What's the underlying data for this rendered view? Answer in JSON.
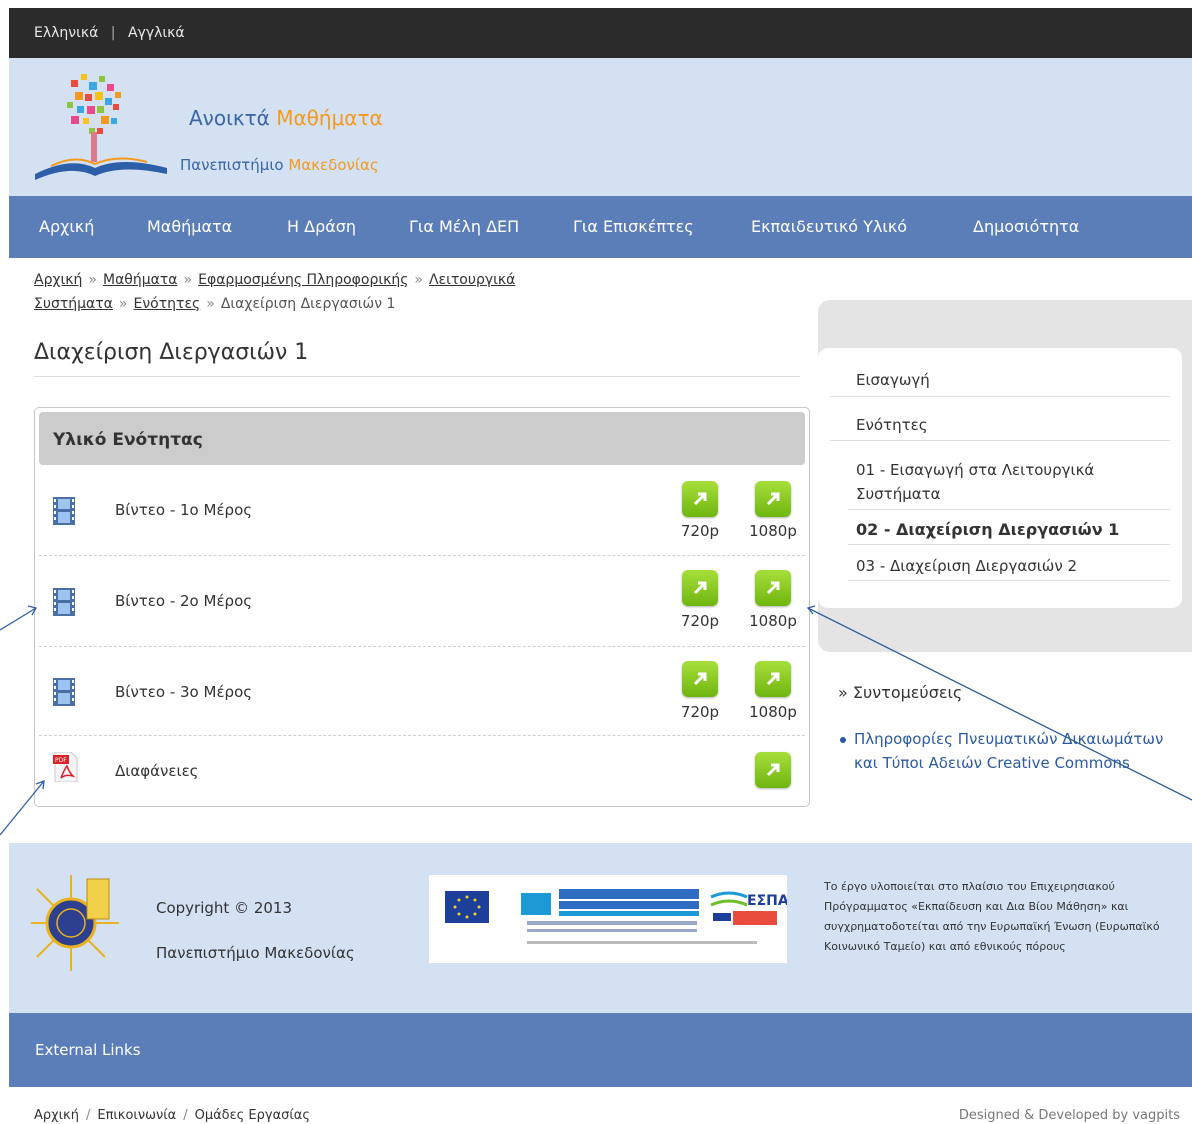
{
  "topbar": {
    "lang_greek": "Ελληνικά",
    "lang_sep": "|",
    "lang_english": "Αγγλικά"
  },
  "header": {
    "title_part1": "Ανοικτά",
    "title_part2": "Μαθήματα",
    "subtitle_part1": "Πανεπιστήμιο",
    "subtitle_part2": "Μακεδονίας"
  },
  "nav": {
    "items": [
      "Αρχική",
      "Μαθήματα",
      "Η Δράση",
      "Για Μέλη ΔΕΠ",
      "Για Επισκέπτες",
      "Εκπαιδευτικό Υλικό",
      "Δημοσιότητα"
    ]
  },
  "breadcrumb": {
    "items": [
      "Αρχική",
      "Μαθήματα",
      "Εφαρμοσμένης Πληροφορικής",
      "Λειτουργικά",
      "Συστήματα",
      "Ενότητες"
    ],
    "current": "Διαχείριση Διεργασιών 1",
    "sep": "»"
  },
  "page_title": "Διαχείριση Διεργασιών 1",
  "panel": {
    "title": "Υλικό Ενότητας",
    "rows": [
      {
        "label": "Βίντεο - 1ο Μέρος",
        "type": "video",
        "res1": "720p",
        "res2": "1080p"
      },
      {
        "label": "Βίντεο - 2ο Μέρος",
        "type": "video",
        "res1": "720p",
        "res2": "1080p"
      },
      {
        "label": "Βίντεο - 3ο Μέρος",
        "type": "video",
        "res1": "720p",
        "res2": "1080p"
      },
      {
        "label": "Διαφάνειες",
        "type": "pdf"
      }
    ]
  },
  "sidebar": {
    "intro": "Εισαγωγή",
    "units": "Ενότητες",
    "unit_items": [
      {
        "label": "01 - Εισαγωγή στα Λειτουργικά Συστήματα",
        "active": false
      },
      {
        "label": "02 - Διαχείριση Διεργασιών 1",
        "active": true
      },
      {
        "label": "03 - Διαχείριση Διεργασιών 2",
        "active": false
      }
    ]
  },
  "shortcuts": {
    "title": "» Συντομεύσεις",
    "link_line1": "Πληροφορίες Πνευματικών Δικαιωμάτων",
    "link_line2": "και Τύποι Αδειών Creative Commons"
  },
  "footer": {
    "copyright": "Copyright © 2013",
    "university": "Πανεπιστήμιο Μακεδονίας",
    "banner_logo_text": "ΕΣΠΑ 2007-2013 Ευρωπαϊκή Ένωση ΕΠΙΧΕΙΡΗΣΙΑΚΟ ΠΡΟΓΡΑΜΜΑ ΕΚΠΑΙΔΕΥΣΗ ΚΑΙ ΔΙΑ ΒΙΟΥ ΜΑΘΗΣΗ",
    "funding_text": "Το έργο υλοποιείται στο πλαίσιο του Επιχειρησιακού Πρόγραμματος «Εκπαίδευση και Δια Βίου Μάθηση» και συγχρηματοδοτείται από την Ευρωπαϊκή Ένωση (Ευρωπαϊκό Κοινωνικό Ταμείο) και από εθνικούς πόρους"
  },
  "external_links": "External Links",
  "bottom": {
    "links": [
      "Αρχική",
      "Επικοινωνία",
      "Ομάδες Εργασίας"
    ],
    "sep": "/",
    "designed_by": "Designed & Developed by vagpits"
  },
  "colors": {
    "nav_blue": "#5b7db8",
    "header_light": "#d3e1f3",
    "green_button": "#7bc21a",
    "orange": "#f39a1e",
    "link_blue": "#2b5aa0"
  },
  "icons": {
    "video": "film-icon",
    "pdf": "pdf-icon",
    "download": "arrow-up-right-icon",
    "logo": "tree-book-logo",
    "footer_logo": "university-seal"
  }
}
